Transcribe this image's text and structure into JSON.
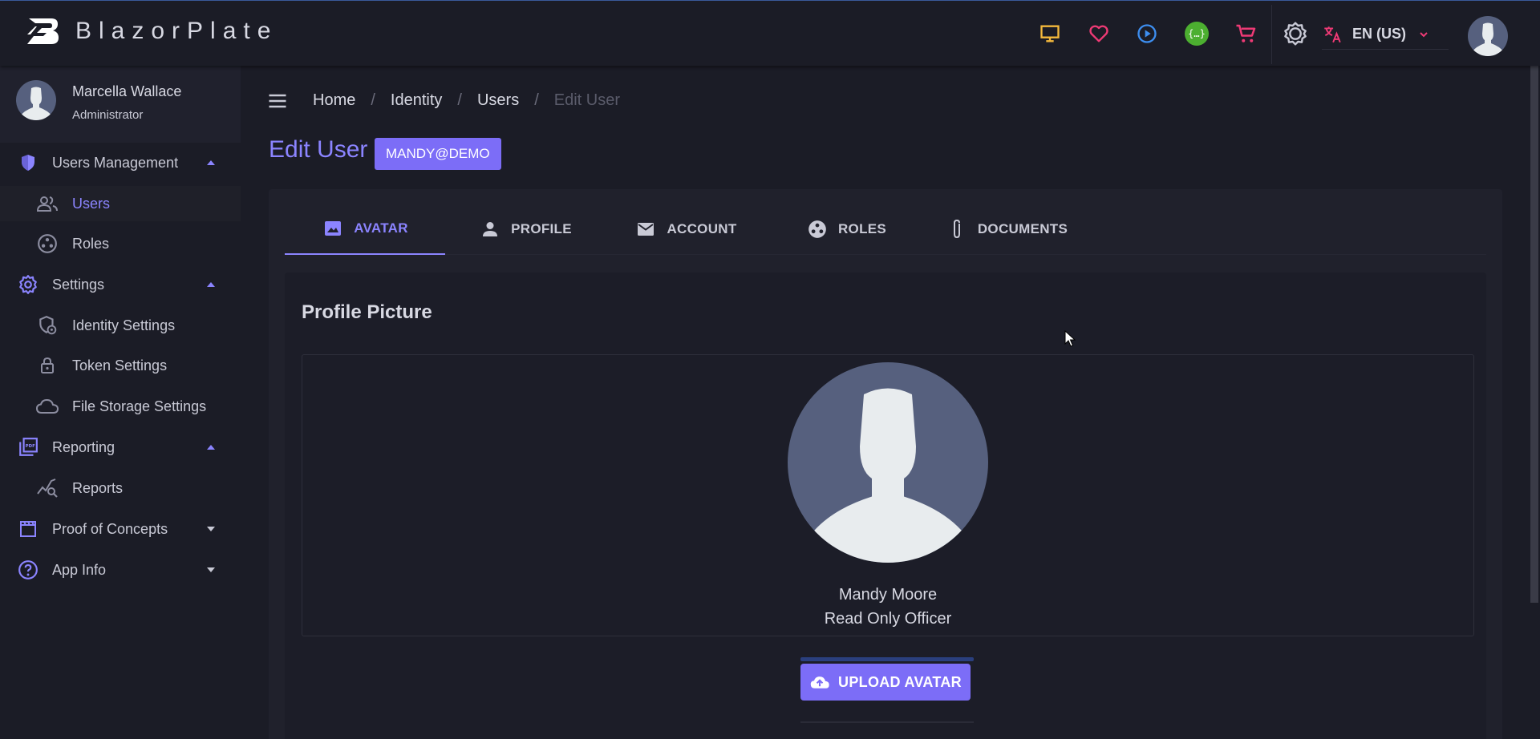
{
  "app": {
    "name": "BlazorPlate"
  },
  "topbar": {
    "icons": [
      "monitor-icon",
      "heart-icon",
      "play-circle-icon",
      "api-icon",
      "cart-icon",
      "theme-toggle-icon"
    ],
    "language": "EN (US)"
  },
  "colors": {
    "accent": "#8b84ff",
    "button": "#7c6df7",
    "background": "#1b1c26",
    "monitor": "#f5b93c",
    "heart": "#ee3a75",
    "play": "#3d8ef0",
    "api": "#4caf30",
    "cart": "#ee3a75"
  },
  "user": {
    "name": "Marcella Wallace",
    "role": "Administrator"
  },
  "sidebar": {
    "users_management": "Users Management",
    "users": "Users",
    "roles": "Roles",
    "settings": "Settings",
    "identity_settings": "Identity Settings",
    "token_settings": "Token Settings",
    "file_storage_settings": "File Storage Settings",
    "reporting": "Reporting",
    "reports": "Reports",
    "proof_of_concepts": "Proof of Concepts",
    "app_info": "App Info"
  },
  "breadcrumb": [
    "Home",
    "Identity",
    "Users",
    "Edit User"
  ],
  "page": {
    "title": "Edit User",
    "chip": "MANDY@DEMO"
  },
  "tabs": [
    "AVATAR",
    "PROFILE",
    "ACCOUNT",
    "ROLES",
    "DOCUMENTS"
  ],
  "avatar_panel": {
    "title": "Profile Picture",
    "name": "Mandy Moore",
    "role": "Read Only Officer",
    "upload_label": "UPLOAD AVATAR"
  }
}
